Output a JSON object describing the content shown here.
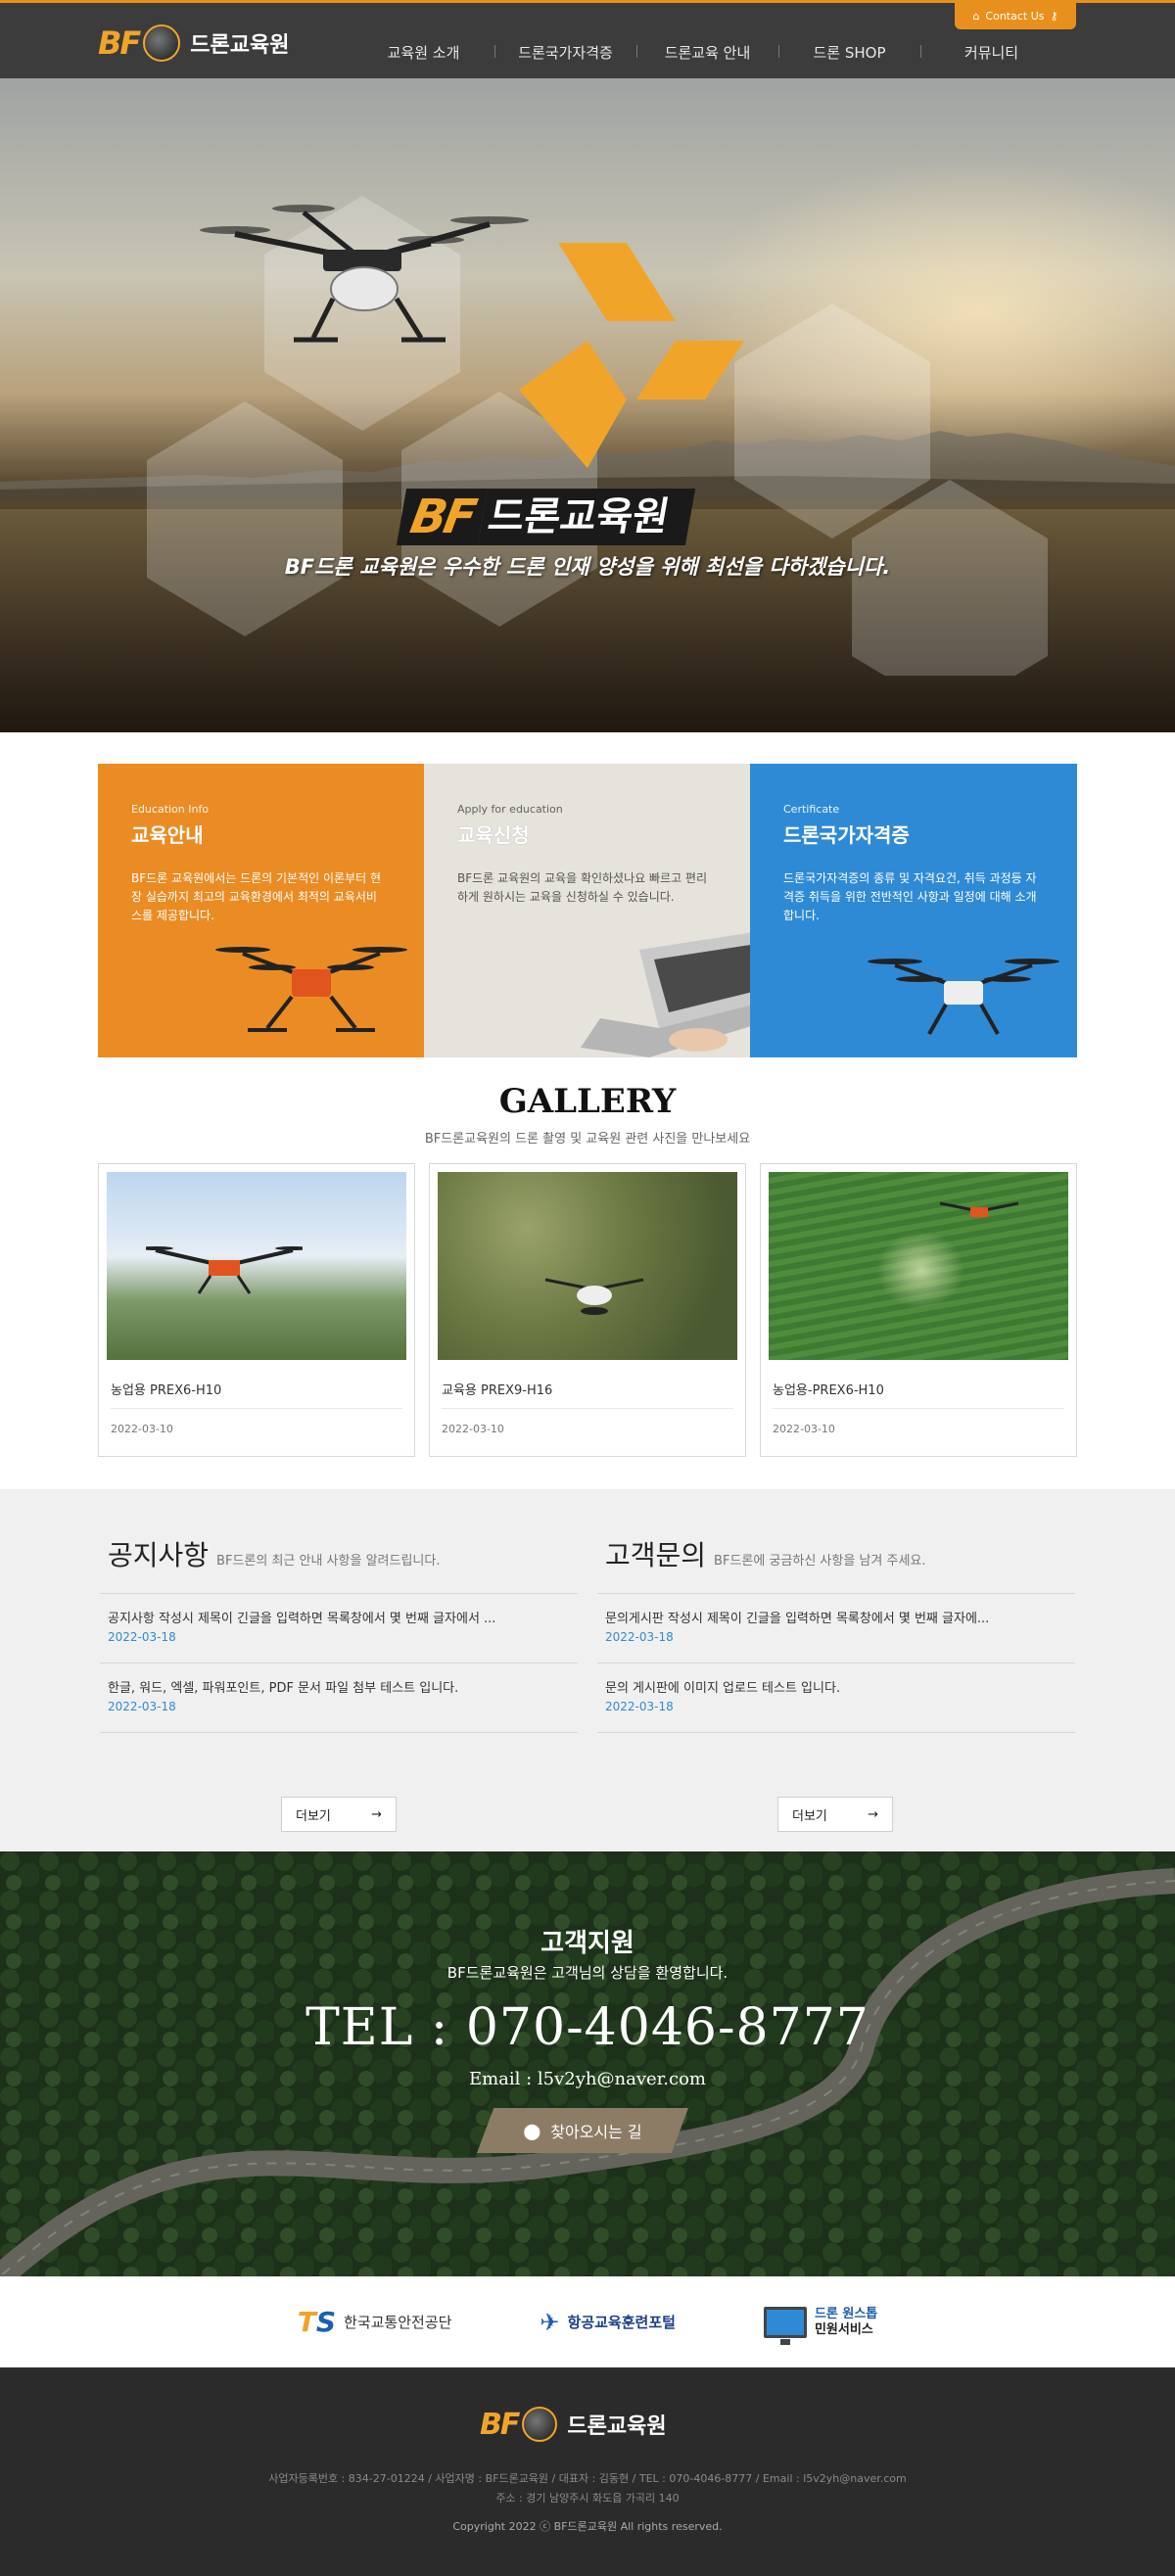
{
  "brand": {
    "logo_mark": "BF",
    "name": "드론교육원"
  },
  "header": {
    "contact_label": "Contact Us",
    "nav": [
      "교육원 소개",
      "드론국가자격증",
      "드론교육 안내",
      "드론 SHOP",
      "커뮤니티"
    ]
  },
  "hero": {
    "brand_mark": "BF",
    "brand_name": "드론교육원",
    "slogan": "BF드론 교육원은 우수한 드론 인재 양성을 위해 최선을 다하겠습니다."
  },
  "cards": [
    {
      "sub": "Education Info",
      "title": "교육안내",
      "desc": "BF드론 교육원에서는 드론의 기본적인 이론부터 현장 실습까지 최고의 교육환경에서 최적의 교육서비스를 제공합니다."
    },
    {
      "sub": "Apply for education",
      "title": "교육신청",
      "desc": "BF드론 교육원의 교육을 확인하셨나요 빠르고 편리하게 원하시는 교육을 신청하실 수 있습니다."
    },
    {
      "sub": "Certificate",
      "title": "드론국가자격증",
      "desc": "드론국가자격증의 종류 및 자격요건, 취득 과정등 자격증 취득을 위한 전반적인 사항과 일정에 대해 소개합니다."
    }
  ],
  "gallery": {
    "title": "GALLERY",
    "subtitle": "BF드론교육원의 드론 촬영 및 교육원 관련 사진을 만나보세요",
    "items": [
      {
        "title": "농업용 PREX6-H10",
        "date": "2022-03-10"
      },
      {
        "title": "교육용 PREX9-H16",
        "date": "2022-03-10"
      },
      {
        "title": "농업용-PREX6-H10",
        "date": "2022-03-10"
      }
    ]
  },
  "notice": {
    "title": "공지사항",
    "subtitle": "BF드론의 최근 안내 사항을 알려드립니다.",
    "rows": [
      {
        "title": "공지사항 작성시 제목이 긴글을 입력하면 목록창에서 몇 번째 글자에서 ...",
        "date": "2022-03-18"
      },
      {
        "title": "한글, 워드, 엑셀, 파워포인트, PDF 문서 파일 첨부 테스트 입니다.",
        "date": "2022-03-18"
      }
    ],
    "more": "더보기"
  },
  "inquiry": {
    "title": "고객문의",
    "subtitle": "BF드론에 궁금하신 사항을 남겨 주세요.",
    "rows": [
      {
        "title": "문의게시판 작성시 제목이 긴글을 입력하면 목록창에서 몇 번째 글자에...",
        "date": "2022-03-18"
      },
      {
        "title": "문의 게시판에 이미지 업로드 테스트 입니다.",
        "date": "2022-03-18"
      }
    ],
    "more": "더보기"
  },
  "support": {
    "title": "고객지원",
    "subtitle": "BF드론교육원은 고객님의 상담을 환영합니다.",
    "tel": "TEL : 070-4046-8777",
    "email": "Email : l5v2yh@naver.com",
    "map_button": "찾아오시는 길"
  },
  "partners": {
    "p1_mark_t": "T",
    "p1_mark_s": "S",
    "p1": "한국교통안전공단",
    "p2": "항공교육훈련포털",
    "p3_a": "드론 원스톱",
    "p3_b": "민원서비스"
  },
  "footer": {
    "logo_mark": "BF",
    "name": "드론교육원",
    "info1": "사업자등록번호 : 834-27-01224 / 사업자명 : BF드론교육원 / 대표자 : 김동현 / TEL : 070-4046-8777 / Email : l5v2yh@naver.com",
    "info2": "주소 : 경기 남양주시 화도읍 가곡리 140",
    "copyright": "Copyright 2022 ⓒ BF드론교육원 All rights reserved."
  },
  "colors": {
    "accent": "#e8901e",
    "blue": "#2f8ad6",
    "header": "#3c3c3c",
    "footer": "#2b2b2b"
  }
}
